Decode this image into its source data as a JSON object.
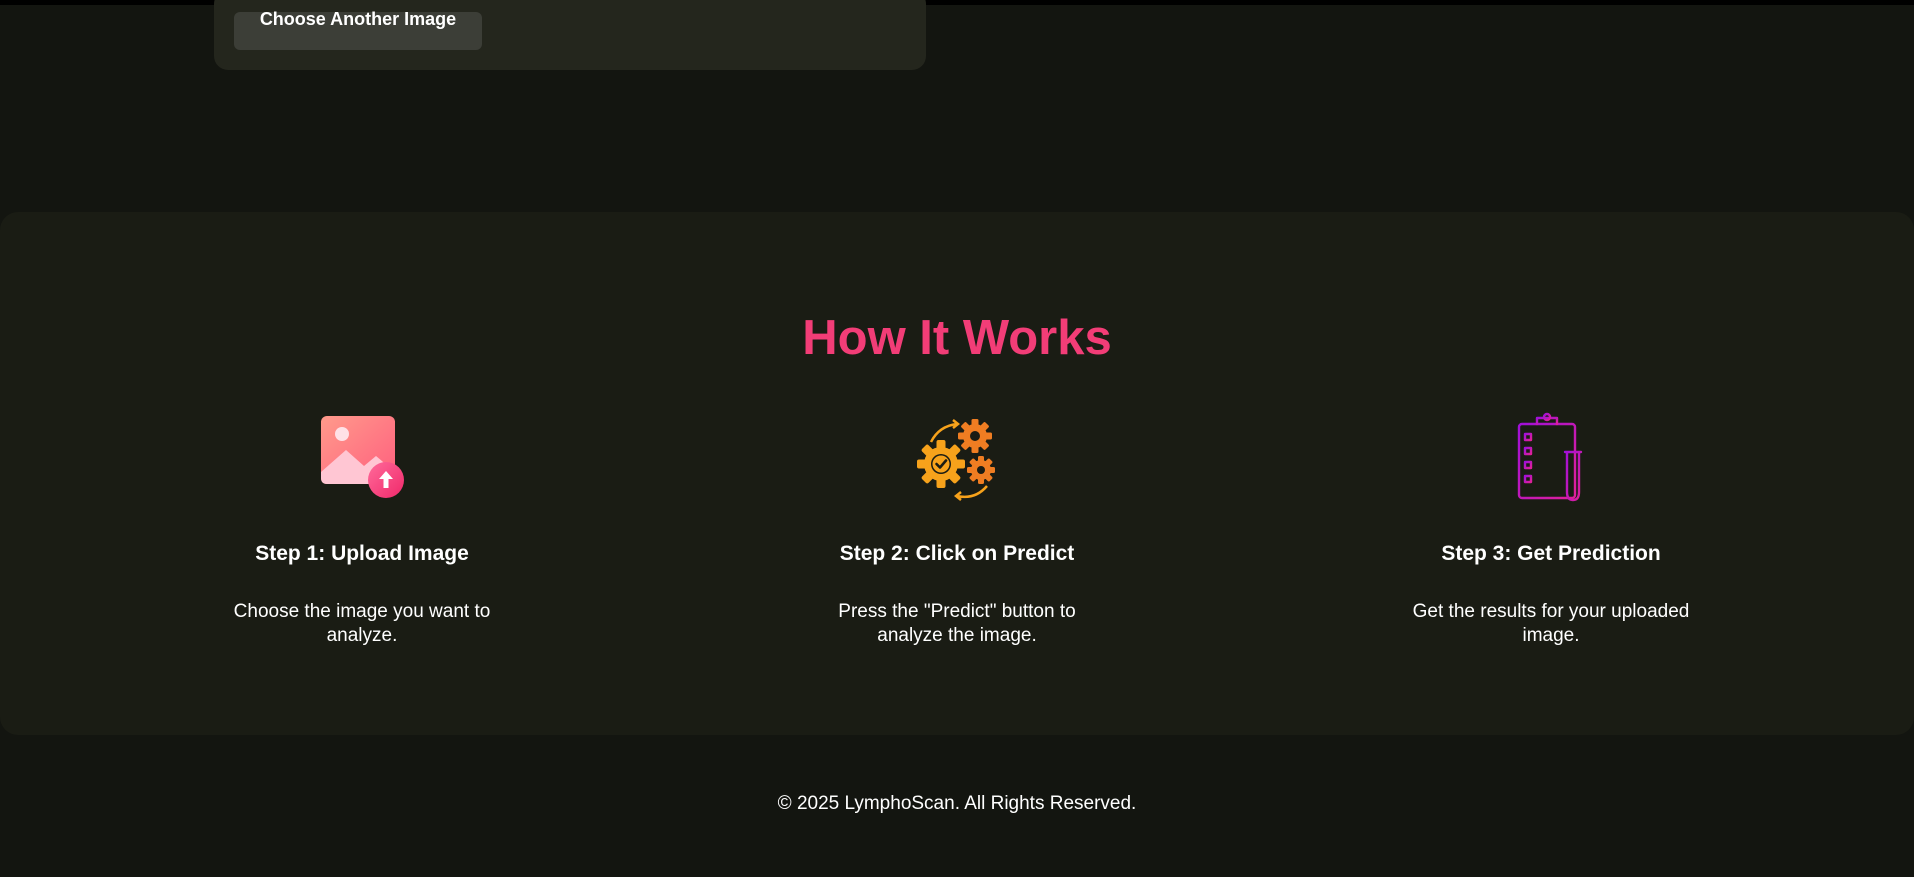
{
  "upload": {
    "button_label": "Choose Another Image"
  },
  "how_it_works": {
    "title": "How It Works",
    "steps": [
      {
        "icon": "image-upload-icon",
        "title": "Step 1: Upload Image",
        "description": "Choose the image you want to analyze."
      },
      {
        "icon": "gears-check-icon",
        "title": "Step 2: Click on Predict",
        "description": "Press the \"Predict\" button to analyze the image."
      },
      {
        "icon": "clipboard-test-tube-icon",
        "title": "Step 3: Get Prediction",
        "description": "Get the results for your uploaded image."
      }
    ]
  },
  "footer": {
    "copyright": "© 2025 LymphoScan. All Rights Reserved."
  },
  "colors": {
    "background": "#131510",
    "section_background": "#1a1c14",
    "card_background": "#24261d",
    "accent_pink": "#f23d77",
    "button_background": "#3c3e37"
  }
}
